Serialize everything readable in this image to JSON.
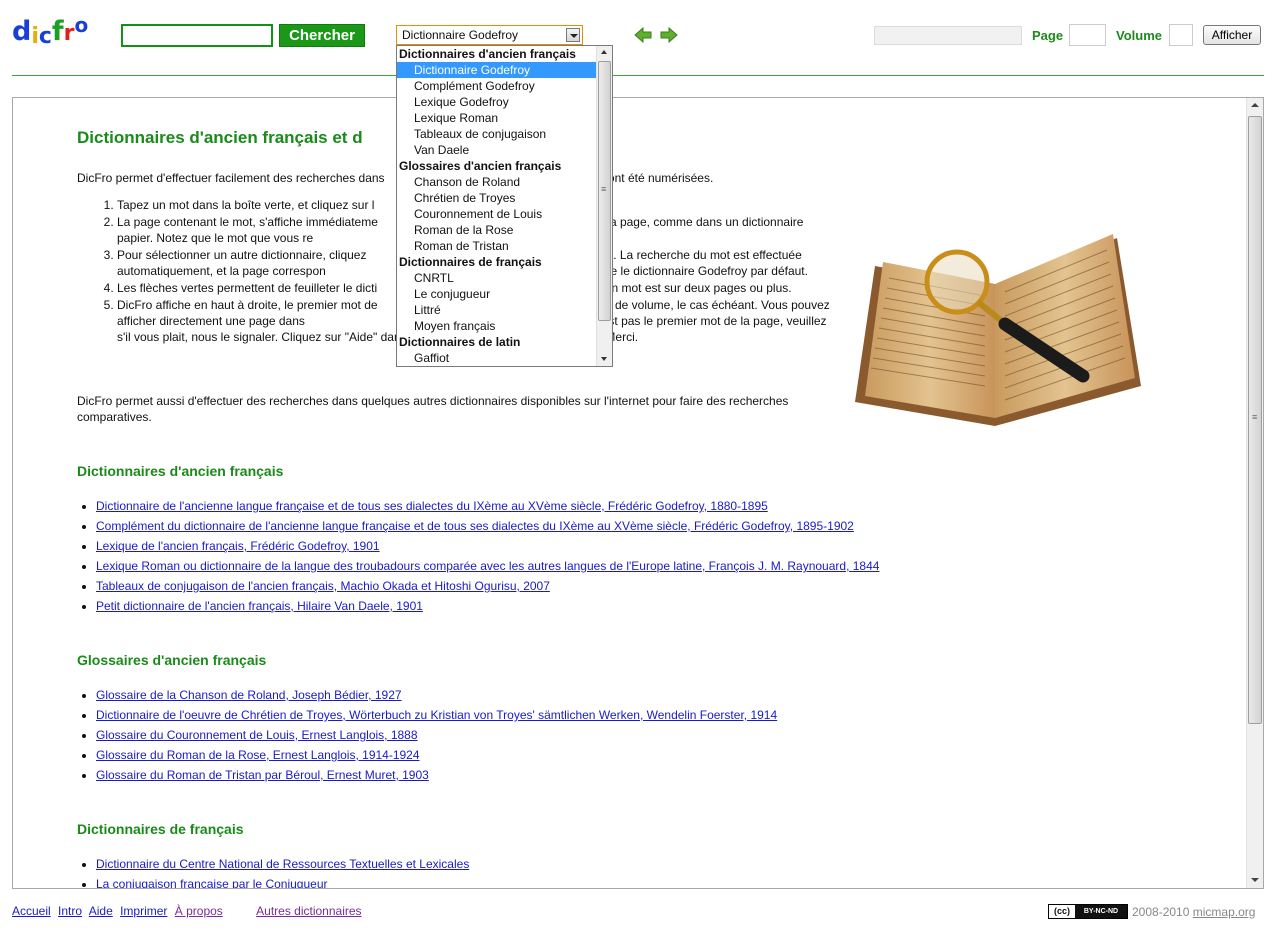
{
  "logo": {
    "letters": [
      "d",
      "i",
      "c",
      "f",
      "r",
      "o"
    ],
    "colors": [
      "#1a3fd6",
      "#e8ac0c",
      "#1a3fd6",
      "#1aa023",
      "#e0201c",
      "#1a3fd6"
    ]
  },
  "search": {
    "value": "",
    "button_label": "Chercher"
  },
  "dictionary_select": {
    "selected": "Dictionnaire Godefroy"
  },
  "dropdown": {
    "groups": [
      {
        "label": "Dictionnaires d'ancien français",
        "options": [
          "Dictionnaire Godefroy",
          "Complément Godefroy",
          "Lexique Godefroy",
          "Lexique Roman",
          "Tableaux de conjugaison",
          "Van Daele"
        ]
      },
      {
        "label": "Glossaires d'ancien français",
        "options": [
          "Chanson de Roland",
          "Chrétien de Troyes",
          "Couronnement de Louis",
          "Roman de la Rose",
          "Roman de Tristan"
        ]
      },
      {
        "label": "Dictionnaires de français",
        "options": [
          "CNRTL",
          "Le conjugueur",
          "Littré",
          "Moyen français"
        ]
      },
      {
        "label": "Dictionnaires de latin",
        "options": [
          "Gaffiot"
        ]
      }
    ],
    "selected": "Dictionnaire Godefroy"
  },
  "toolbar": {
    "page_label": "Page",
    "volume_label": "Volume",
    "show_button": "Afficher"
  },
  "main": {
    "title": "Dictionnaires d'ancien français et d",
    "intro": "DicFro permet d'effectuer facilement des recherches dans                                                                   ont été numérisées.",
    "steps": [
      "Tapez un mot dans la boîte verte, et cliquez sur l",
      "La page contenant le mot, s'affiche immédiateme                                                          t dans la page, comme dans un dictionnaire papier. Notez que le mot que vous re                                                          s ce dictionnaire.",
      "Pour sélectionner un autre dictionnaire, cliquez                                                            uton vert. La recherche du mot est effectuée automatiquement, et la page correspon                                                          sitôt. DicFro utilise le dictionnaire Godefroy par défaut.",
      "Les flèches vertes permettent de feuilleter le dicti                                                        nition d'un mot est sur deux pages ou plus.",
      "DicFro affiche en haut à droite, le premier mot de                                                          numéro de volume, le cas échéant. Vous pouvez afficher directement une page dans                                                         que le mot affiché n'est pas le premier mot de la page, veuillez s'il vous plait, nous le signaler. Cliquez sur \"Aide\" dans la barre du bas pour nous contacter. Merci."
    ],
    "outro": "DicFro permet aussi d'effectuer des recherches dans quelques autres dictionnaires disponibles sur l'internet pour faire des recherches comparatives.",
    "sections": [
      {
        "heading": "Dictionnaires d'ancien français",
        "links": [
          "Dictionnaire de l'ancienne langue française et de tous ses dialectes du IXème au XVème siècle, Frédéric Godefroy, 1880-1895",
          "Complément du dictionnaire de l'ancienne langue française et de tous ses dialectes du IXème au XVème siècle, Frédéric Godefroy, 1895-1902",
          "Lexique de l'ancien français, Frédéric Godefroy, 1901",
          "Lexique Roman ou dictionnaire de la langue des troubadours comparée avec les autres langues de l'Europe latine, François J. M. Raynouard, 1844",
          "Tableaux de conjugaison de l'ancien français, Machio Okada et Hitoshi Ogurisu, 2007",
          "Petit dictionnaire de l'ancien français, Hilaire Van Daele, 1901"
        ]
      },
      {
        "heading": "Glossaires d'ancien français",
        "links": [
          "Glossaire de la Chanson de Roland, Joseph Bédier, 1927",
          "Dictionnaire de l'oeuvre de Chrétien de Troyes, Wörterbuch zu Kristian von Troyes' sämtlichen Werken, Wendelin Foerster, 1914",
          "Glossaire du Couronnement de Louis, Ernest Langlois, 1888",
          "Glossaire du Roman de la Rose, Ernest Langlois, 1914-1924",
          "Glossaire du Roman de Tristan par Béroul, Ernest Muret, 1903"
        ]
      },
      {
        "heading": "Dictionnaires de français",
        "links": [
          "Dictionnaire du Centre National de Ressources Textuelles et Lexicales",
          "La conjugaison française par le Conjugueur"
        ]
      }
    ]
  },
  "footer": {
    "links": [
      "Accueil",
      "Intro",
      "Aide",
      "Imprimer",
      "À propos"
    ],
    "other": "Autres dictionnaires",
    "license": {
      "cc": "(cc)",
      "terms": "BY-NC-ND"
    },
    "copyright": "2008-2010",
    "site": "micmap.org"
  }
}
